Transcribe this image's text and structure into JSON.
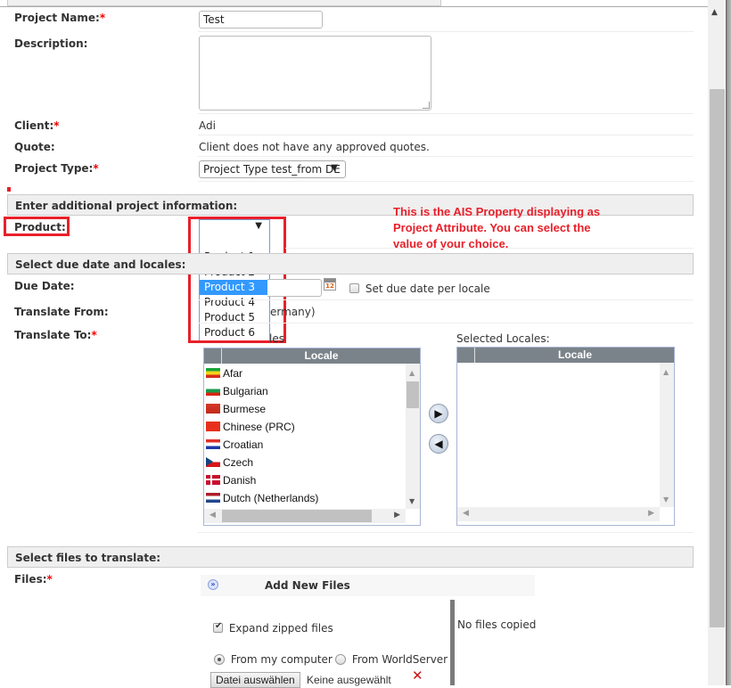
{
  "form": {
    "project_name": {
      "label": "Project Name:",
      "required": "*",
      "value": "Test"
    },
    "description": {
      "label": "Description:",
      "value": ""
    },
    "client": {
      "label": "Client:",
      "required": "*",
      "value": "Adi"
    },
    "quote": {
      "label": "Quote:",
      "value": "Client does not have any approved quotes."
    },
    "project_type": {
      "label": "Project Type:",
      "required": "*",
      "value": "Project Type test_from DE",
      "arrow": "▼"
    }
  },
  "additional_section": {
    "title": "Enter additional project information:",
    "product": {
      "label": "Product:",
      "value": "",
      "arrow": "▼"
    },
    "product_options": [
      "",
      "Product 1",
      "Product 2",
      "Product 3",
      "Product 4",
      "Product 5",
      "Product 6"
    ],
    "product_highlighted": "Product 3"
  },
  "annotation": {
    "line1": "This is the AIS Property displaying as",
    "line2": "Project Attribute. You can select the",
    "line3": "value of your choice.",
    "color": "#e8202a"
  },
  "locales_section": {
    "title": "Select due date and locales:",
    "due_date": {
      "label": "Due Date:",
      "value": "",
      "icon": "calendar-icon",
      "per_locale_label": "Set due date per locale"
    },
    "translate_from": {
      "label": "Translate From:",
      "value_visible": "ermany)"
    },
    "translate_to": {
      "label": "Translate To:",
      "required": "*"
    },
    "available_label_visible": "les",
    "selected_label": "Selected Locales:",
    "column_header": "Locale",
    "available_locales": [
      {
        "name": "Afar",
        "flag": "afar"
      },
      {
        "name": "Bulgarian",
        "flag": "bulgaria"
      },
      {
        "name": "Burmese",
        "flag": "burma"
      },
      {
        "name": "Chinese (PRC)",
        "flag": "china"
      },
      {
        "name": "Croatian",
        "flag": "croatia"
      },
      {
        "name": "Czech",
        "flag": "czech"
      },
      {
        "name": "Danish",
        "flag": "denmark"
      },
      {
        "name": "Dutch (Netherlands)",
        "flag": "netherlands"
      }
    ],
    "selected_locales": [],
    "add_arrow": "▶",
    "remove_arrow": "◀"
  },
  "files_section": {
    "title": "Select files to translate:",
    "files_label": "Files:",
    "required": "*",
    "add_new_files": "Add New Files",
    "expand_zipped": "Expand zipped files",
    "expand_zipped_checked": true,
    "source_options": [
      "From my computer",
      "From WorldServer"
    ],
    "source_selected": "From my computer",
    "choose_file_button": "Datei auswählen",
    "no_file_chosen": "Keine ausgewählt",
    "no_files_copied": "No files copied",
    "remove_icon": "✕"
  }
}
